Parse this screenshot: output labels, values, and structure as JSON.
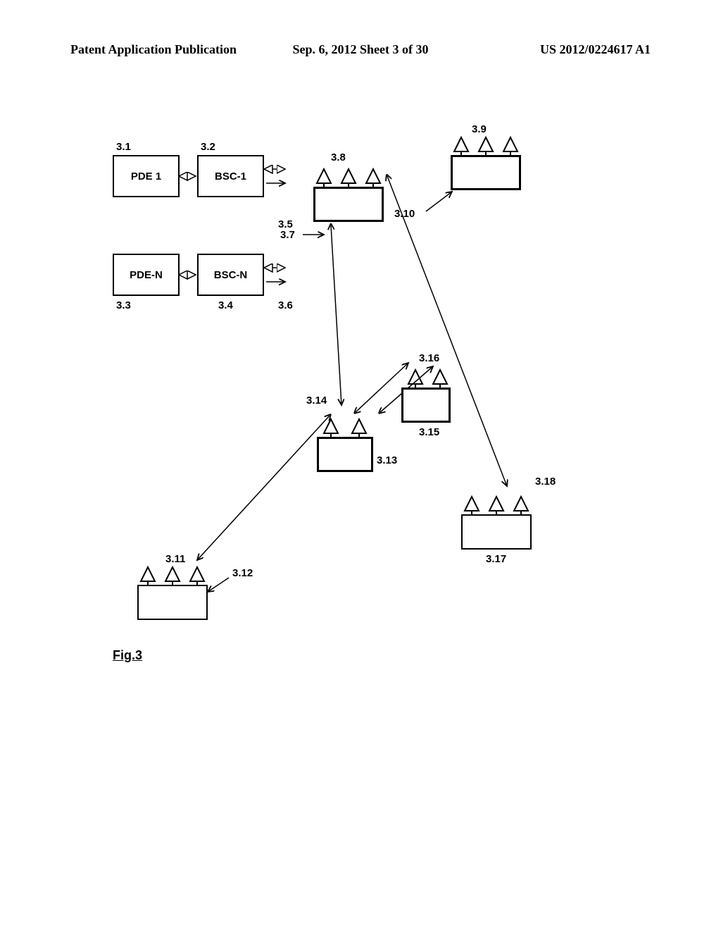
{
  "header": {
    "left": "Patent Application Publication",
    "center": "Sep. 6, 2012  Sheet 3 of 30",
    "right": "US 2012/0224617 A1"
  },
  "boxes": {
    "pde1": "PDE 1",
    "bsc1": "BSC-1",
    "pden": "PDE-N",
    "bscn": "BSC-N"
  },
  "labels": {
    "l31": "3.1",
    "l32": "3.2",
    "l33": "3.3",
    "l34": "3.4",
    "l35": "3.5",
    "l36": "3.6",
    "l37": "3.7",
    "l38": "3.8",
    "l39": "3.9",
    "l310": "3.10",
    "l311": "3.11",
    "l312": "3.12",
    "l313": "3.13",
    "l314": "3.14",
    "l315": "3.15",
    "l316": "3.16",
    "l317": "3.17",
    "l318": "3.18"
  },
  "figure": "Fig.3"
}
